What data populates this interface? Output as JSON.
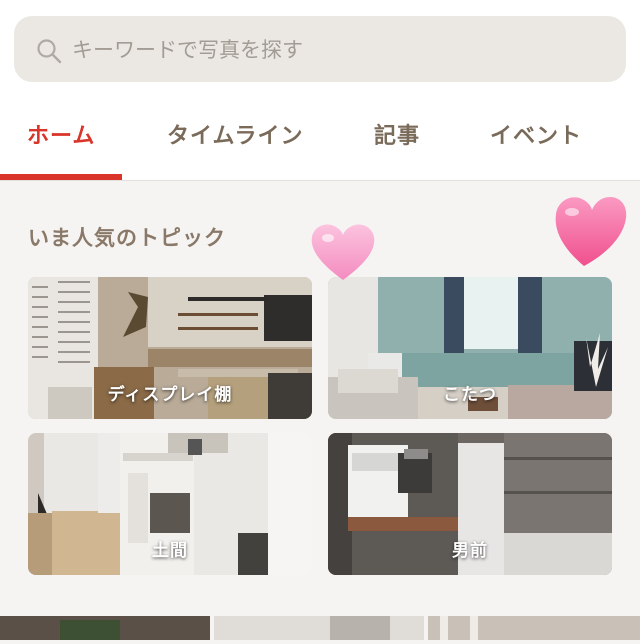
{
  "search": {
    "placeholder": "キーワードで写真を探す",
    "icon": "search-icon"
  },
  "tabs": [
    {
      "label": "ホーム",
      "active": true
    },
    {
      "label": "タイムライン",
      "active": false
    },
    {
      "label": "記事",
      "active": false
    },
    {
      "label": "イベント",
      "active": false
    }
  ],
  "colors": {
    "accent": "#d9352b",
    "tab_text": "#7a6a5a",
    "search_bg": "#ebe8e3",
    "heart": "#f46ba0"
  },
  "section": {
    "title": "いま人気のトピック"
  },
  "topics": [
    {
      "label": "ディスプレイ棚"
    },
    {
      "label": "こたつ"
    },
    {
      "label": "土間"
    },
    {
      "label": "男前"
    }
  ]
}
